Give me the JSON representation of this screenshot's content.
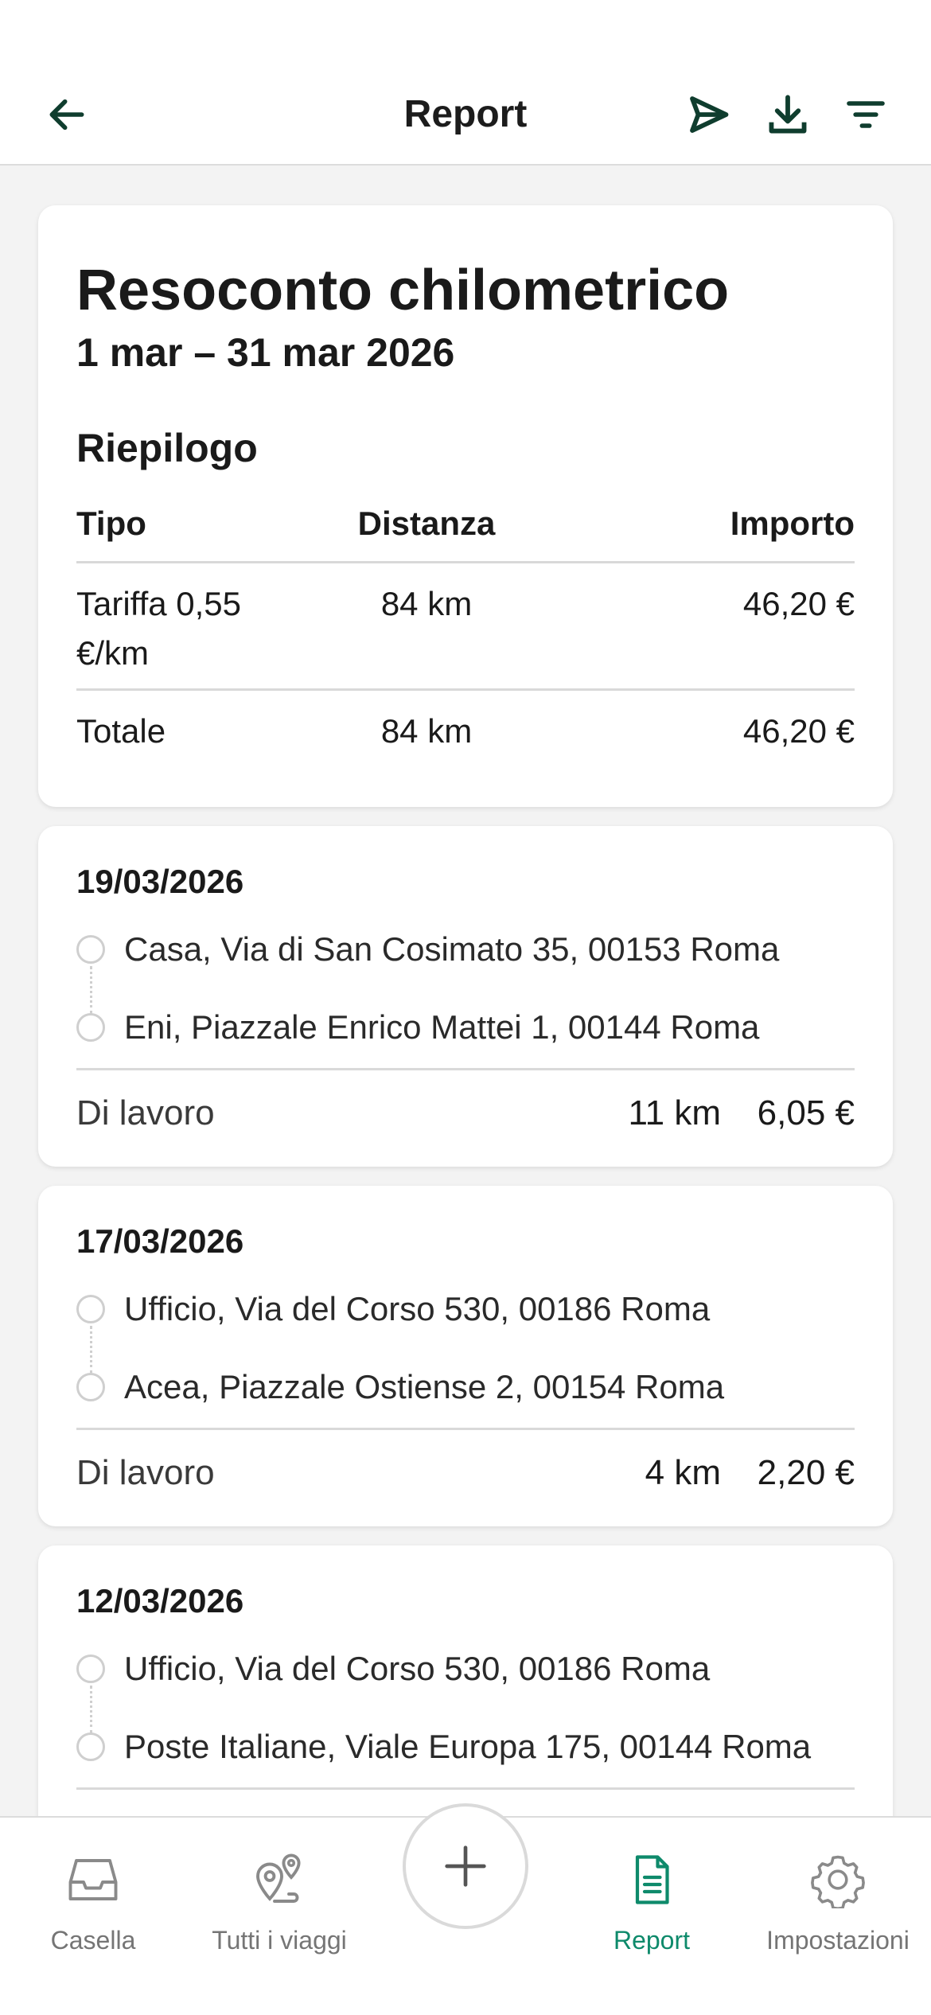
{
  "header": {
    "title": "Report",
    "icons": [
      "back-arrow-icon",
      "send-icon",
      "download-icon",
      "filter-icon"
    ]
  },
  "summary": {
    "title": "Resoconto chilometrico",
    "date_range": "1 mar – 31 mar 2026",
    "section_title": "Riepilogo",
    "columns": [
      "Tipo",
      "Distanza",
      "Importo"
    ],
    "rows": [
      {
        "type": "Tariffa 0,55 €/km",
        "distance": "84 km",
        "amount": "46,20 €"
      },
      {
        "type": "Totale",
        "distance": "84 km",
        "amount": "46,20 €"
      }
    ]
  },
  "trips": [
    {
      "date": "19/03/2026",
      "from": "Casa, Via di San Cosimato 35, 00153 Roma",
      "to": "Eni, Piazzale Enrico Mattei 1, 00144 Roma",
      "category": "Di lavoro",
      "distance": "11 km",
      "amount": "6,05 €"
    },
    {
      "date": "17/03/2026",
      "from": "Ufficio, Via del Corso 530, 00186 Roma",
      "to": "Acea, Piazzale Ostiense 2, 00154 Roma",
      "category": "Di lavoro",
      "distance": "4 km",
      "amount": "2,20 €"
    },
    {
      "date": "12/03/2026",
      "from": "Ufficio, Via del Corso 530, 00186 Roma",
      "to": "Poste Italiane, Viale Europa 175, 00144 Roma"
    }
  ],
  "bottom_nav": {
    "items": [
      {
        "label": "Casella",
        "icon": "inbox-icon"
      },
      {
        "label": "Tutti i viaggi",
        "icon": "map-pin-route-icon"
      },
      {
        "label": "Report",
        "icon": "report-document-icon",
        "active": true
      },
      {
        "label": "Impostazioni",
        "icon": "gear-icon"
      }
    ],
    "add_icon": "plus-icon"
  },
  "colors": {
    "accent": "#0e8a6b",
    "icon_dark": "#0f3d2e",
    "background": "#f3f3f3"
  }
}
